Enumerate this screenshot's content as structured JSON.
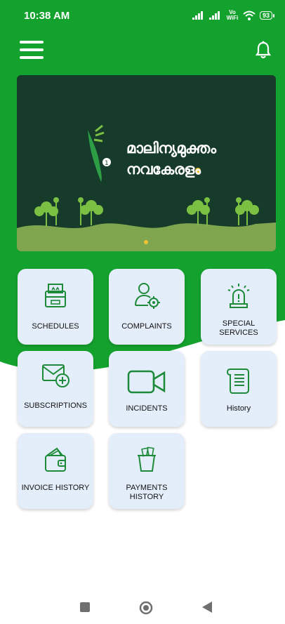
{
  "status_bar": {
    "time": "10:38 AM",
    "network_label": "Vo WiFi",
    "battery": "93"
  },
  "banner": {
    "title_line1": "മാലിന്യമുക്തം",
    "title_line2": "നവകേരളം"
  },
  "tiles": [
    {
      "label": "SCHEDULES"
    },
    {
      "label": "COMPLAINTS"
    },
    {
      "label": "SPECIAL SERVICES"
    },
    {
      "label": "SUBSCRIPTIONS"
    },
    {
      "label": "INCIDENTS"
    },
    {
      "label": "History"
    },
    {
      "label": "INVOICE HISTORY"
    },
    {
      "label": "PAYMENTS HISTORY"
    }
  ],
  "colors": {
    "primary_green": "#14a22e",
    "tile_bg": "#e4eefa",
    "banner_bg": "#163b2b",
    "accent_dot": "#f2c230"
  }
}
